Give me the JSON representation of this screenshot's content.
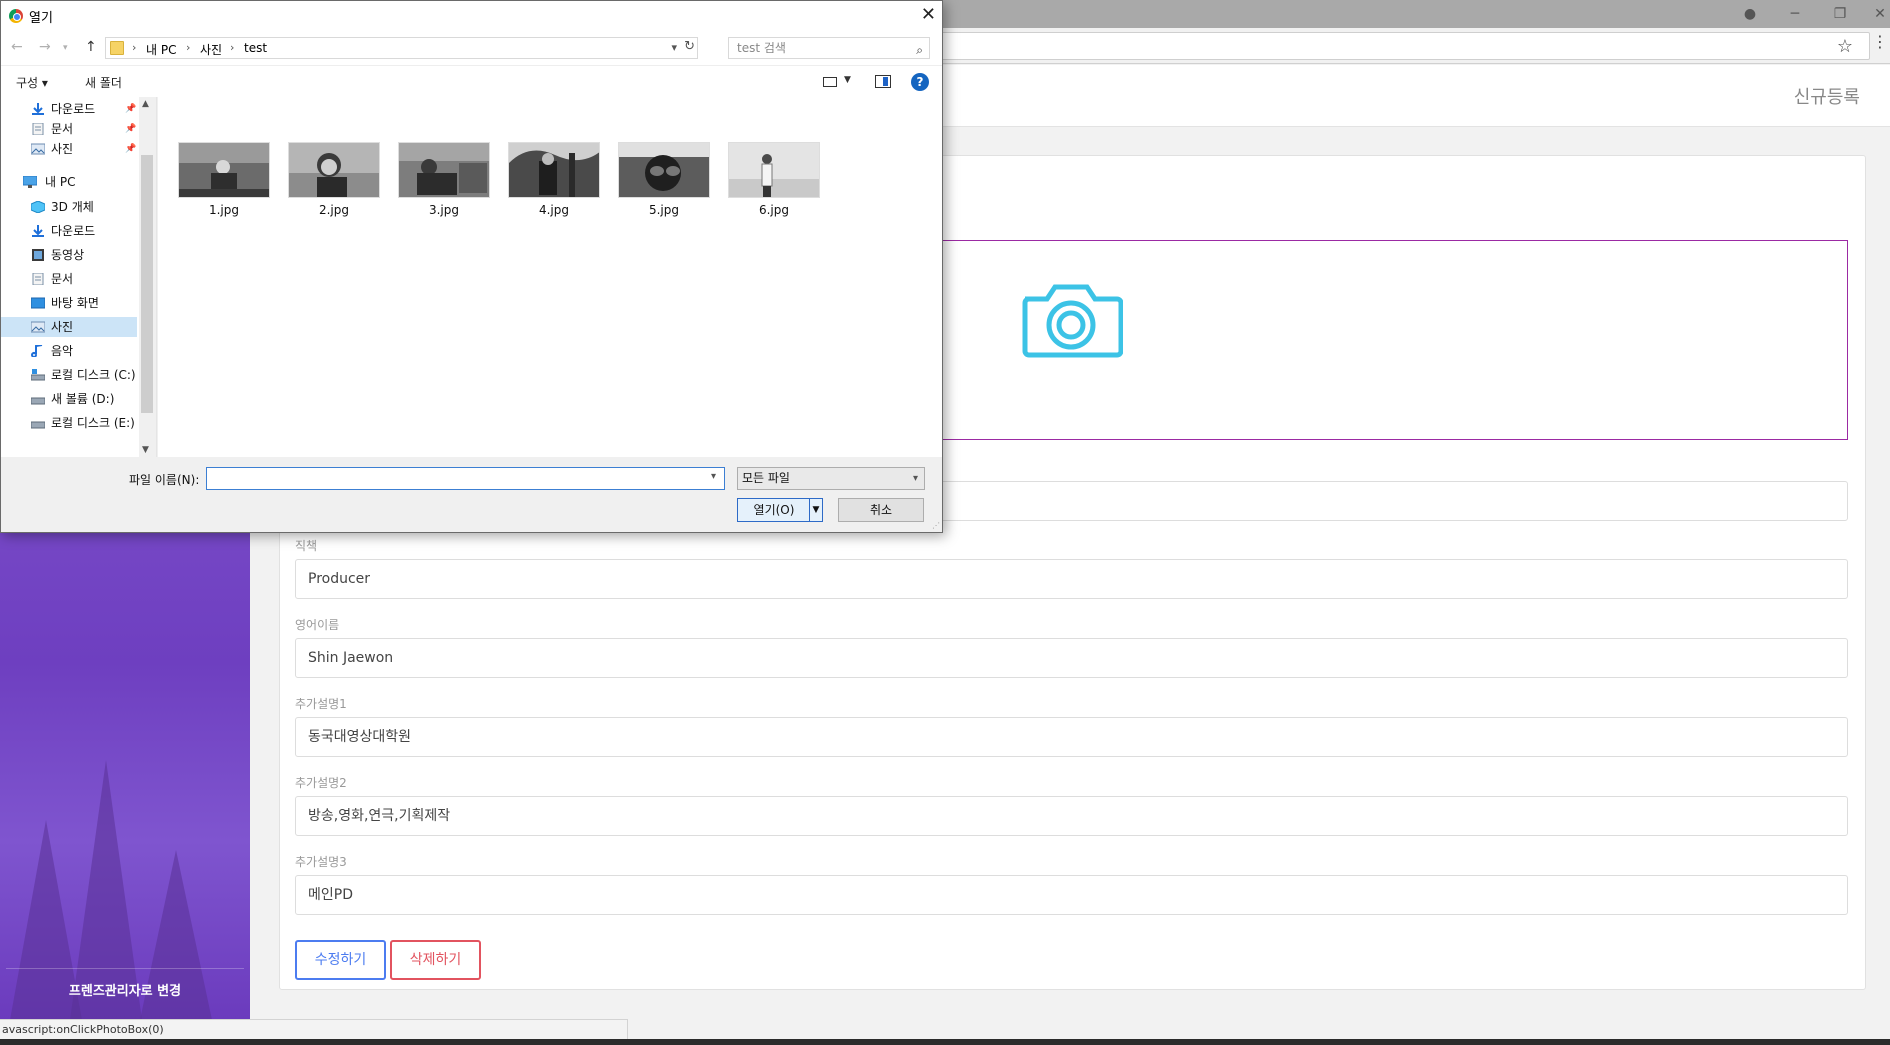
{
  "dialog": {
    "title": "열기",
    "close_glyph": "✕",
    "breadcrumb": [
      "내 PC",
      "사진",
      "test"
    ],
    "search_placeholder": "test 검색",
    "toolbar": {
      "organize": "구성 ▾",
      "new_folder": "새 폴더",
      "help": "?"
    },
    "nav_items": [
      {
        "label": "다운로드",
        "icon": "download-icon",
        "pinned": true
      },
      {
        "label": "문서",
        "icon": "document-icon",
        "pinned": true
      },
      {
        "label": "사진",
        "icon": "pictures-icon",
        "pinned": true
      },
      {
        "label": "내 PC",
        "icon": "pc-icon"
      },
      {
        "label": "3D 개체",
        "icon": "3d-objects-icon"
      },
      {
        "label": "다운로드",
        "icon": "download-icon"
      },
      {
        "label": "동영상",
        "icon": "video-icon"
      },
      {
        "label": "문서",
        "icon": "document-icon"
      },
      {
        "label": "바탕 화면",
        "icon": "desktop-icon"
      },
      {
        "label": "사진",
        "icon": "pictures-icon",
        "selected": true
      },
      {
        "label": "음악",
        "icon": "music-icon"
      },
      {
        "label": "로컬 디스크 (C:)",
        "icon": "drive-icon"
      },
      {
        "label": "새 볼륨 (D:)",
        "icon": "drive-icon"
      },
      {
        "label": "로컬 디스크 (E:)",
        "icon": "drive-icon"
      }
    ],
    "files": [
      {
        "name": "1.jpg"
      },
      {
        "name": "2.jpg"
      },
      {
        "name": "3.jpg"
      },
      {
        "name": "4.jpg"
      },
      {
        "name": "5.jpg"
      },
      {
        "name": "6.jpg"
      }
    ],
    "filename_label": "파일 이름(N):",
    "filename_value": "",
    "filetype_selected": "모든 파일",
    "open_button": "열기(O)",
    "cancel_button": "취소"
  },
  "page": {
    "header_title": "신규등록",
    "fields": [
      {
        "label": "직책",
        "value": "Producer"
      },
      {
        "label": "영어이름",
        "value": "Shin Jaewon"
      },
      {
        "label": "추가설명1",
        "value": "동국대영상대학원"
      },
      {
        "label": "추가설명2",
        "value": "방송,영화,연극,기획제작"
      },
      {
        "label": "추가설명3",
        "value": "메인PD"
      }
    ],
    "edit_button": "수정하기",
    "delete_button": "삭제하기",
    "sidebar_button": "프렌즈관리자로 변경",
    "status_text": "avascript:onClickPhotoBox(0)"
  },
  "colors": {
    "sidebar_purple": "#7a4cc9",
    "photo_box_border": "#9b2aa3",
    "camera_icon": "#3cc3e6",
    "edit_blue": "#4c7cf0",
    "delete_red": "#e2535f"
  }
}
